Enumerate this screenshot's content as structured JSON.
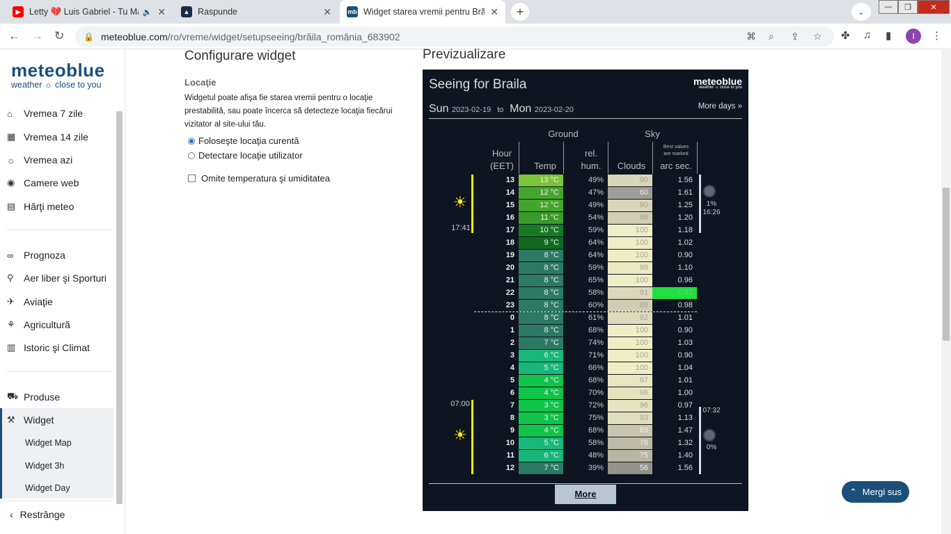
{
  "tabs": [
    {
      "title": "Letty 💔 Luis Gabriel - Tu Ma",
      "icon": "youtube-icon"
    },
    {
      "title": "Raspunde",
      "icon": "brainly-icon"
    },
    {
      "title": "Widget starea vremii pentru Brăil",
      "icon": "mb-icon",
      "icon_text": "mb"
    }
  ],
  "url": {
    "host": "meteoblue.com",
    "path": "/ro/vreme/widget/setupseeing/brăila_românia_683902"
  },
  "avatar": "I",
  "logo": {
    "name": "meteoblue",
    "tagline": "weather ☼ close to you"
  },
  "sidebar": {
    "group1": [
      "Vremea 7 zile",
      "Vremea 14 zile",
      "Vremea azi",
      "Camere web",
      "Hărţi meteo"
    ],
    "group2": [
      "Prognoza",
      "Aer liber şi Sporturi",
      "Aviaţie",
      "Agricultură",
      "Istoric şi Climat"
    ],
    "group3": [
      "Produse",
      "Widget"
    ],
    "sub": [
      "Widget Map",
      "Widget 3h",
      "Widget Day"
    ],
    "collapse": "Restrânge"
  },
  "config": {
    "title": "Configurare widget",
    "location_label": "Locaţie",
    "description": "Widgetul poate afişa fie starea vremii pentru o locaţie prestabilită, sau poate încerca să detecteze locaţia fiecărui vizitator al site-ului tău.",
    "option1": "Foloseşte locaţia curentă",
    "option2": "Detectare locaţie utilizator",
    "checkbox": "Omite temperatura şi umiditatea"
  },
  "preview_title": "Previzualizare",
  "widget": {
    "title": "Seeing for Braila",
    "logo_main": "meteoblue",
    "logo_sub": "weather ☼ close to you",
    "day1": "Sun",
    "date1": "2023-02-19",
    "to": "to",
    "day2": "Mon",
    "date2": "2023-02-20",
    "more_days": "More days »",
    "header": {
      "ground": "Ground",
      "sky": "Sky",
      "hour": "Hour",
      "eet": "(EET)",
      "temp": "Temp",
      "rel": "rel.",
      "hum": "hum.",
      "clouds": "Clouds",
      "best1": "Best values",
      "best2": "are marked",
      "arc": "arc sec."
    },
    "sunset": "17:41",
    "sunrise": "07:00",
    "moon1_pct": "1%",
    "moon1_time": "16:26",
    "moon2_time": "07:32",
    "moon2_pct": "0%",
    "more_button": "More",
    "rows": [
      {
        "h": "13",
        "t": "13 °C",
        "tc": "#7cc43a",
        "hum": "49%",
        "c": "90",
        "cc": "#d8d5b8",
        "a": "1.56"
      },
      {
        "h": "14",
        "t": "12 °C",
        "tc": "#45a62e",
        "hum": "47%",
        "c": "60",
        "cc": "#9d9c96",
        "a": "1.61"
      },
      {
        "h": "15",
        "t": "12 °C",
        "tc": "#45a62e",
        "hum": "49%",
        "c": "90",
        "cc": "#d8d5b8",
        "a": "1.25"
      },
      {
        "h": "16",
        "t": "11 °C",
        "tc": "#3b9a2c",
        "hum": "54%",
        "c": "86",
        "cc": "#d0cdb4",
        "a": "1.20"
      },
      {
        "h": "17",
        "t": "10 °C",
        "tc": "#157a22",
        "hum": "59%",
        "c": "100",
        "cc": "#efedc6",
        "a": "1.18"
      },
      {
        "h": "18",
        "t": "9 °C",
        "tc": "#0f6a20",
        "hum": "64%",
        "c": "100",
        "cc": "#efedc6",
        "a": "1.02"
      },
      {
        "h": "19",
        "t": "8 °C",
        "tc": "#2c7a64",
        "hum": "64%",
        "c": "100",
        "cc": "#efedc6",
        "a": "0.90"
      },
      {
        "h": "20",
        "t": "8 °C",
        "tc": "#2c7a64",
        "hum": "59%",
        "c": "98",
        "cc": "#ebe9c3",
        "a": "1.10"
      },
      {
        "h": "21",
        "t": "8 °C",
        "tc": "#2c7a64",
        "hum": "65%",
        "c": "100",
        "cc": "#efedc6",
        "a": "0.96"
      },
      {
        "h": "22",
        "t": "8 °C",
        "tc": "#2c7a64",
        "hum": "58%",
        "c": "91",
        "cc": "#dcd9bb",
        "a": "0.82",
        "best": true
      },
      {
        "h": "23",
        "t": "8 °C",
        "tc": "#2c7a64",
        "hum": "60%",
        "c": "86",
        "cc": "#d0cdb4",
        "a": "0.98"
      },
      {
        "h": "0",
        "t": "8 °C",
        "tc": "#2c7a64",
        "hum": "61%",
        "c": "92",
        "cc": "#dedbbc",
        "a": "1.01"
      },
      {
        "h": "1",
        "t": "8 °C",
        "tc": "#2c7a64",
        "hum": "68%",
        "c": "100",
        "cc": "#efedc6",
        "a": "0.90"
      },
      {
        "h": "2",
        "t": "7 °C",
        "tc": "#2c7a64",
        "hum": "74%",
        "c": "100",
        "cc": "#efedc6",
        "a": "1.03"
      },
      {
        "h": "3",
        "t": "6 °C",
        "tc": "#17b87a",
        "hum": "71%",
        "c": "100",
        "cc": "#efedc6",
        "a": "0.90"
      },
      {
        "h": "4",
        "t": "5 °C",
        "tc": "#17b87a",
        "hum": "66%",
        "c": "100",
        "cc": "#efedc6",
        "a": "1.04"
      },
      {
        "h": "5",
        "t": "4 °C",
        "tc": "#0fc448",
        "hum": "68%",
        "c": "97",
        "cc": "#e9e7c2",
        "a": "1.01"
      },
      {
        "h": "6",
        "t": "4 °C",
        "tc": "#0fc448",
        "hum": "70%",
        "c": "96",
        "cc": "#e6e4c0",
        "a": "1.00"
      },
      {
        "h": "7",
        "t": "3 °C",
        "tc": "#0fc448",
        "hum": "72%",
        "c": "96",
        "cc": "#e6e4c0",
        "a": "0.97"
      },
      {
        "h": "8",
        "t": "3 °C",
        "tc": "#0fc448",
        "hum": "75%",
        "c": "93",
        "cc": "#e0ddbd",
        "a": "1.13"
      },
      {
        "h": "9",
        "t": "4 °C",
        "tc": "#0fc448",
        "hum": "68%",
        "c": "83",
        "cc": "#c9c6ae",
        "a": "1.47"
      },
      {
        "h": "10",
        "t": "5 °C",
        "tc": "#17b87a",
        "hum": "58%",
        "c": "78",
        "cc": "#bdbba6",
        "a": "1.32"
      },
      {
        "h": "11",
        "t": "6 °C",
        "tc": "#17b87a",
        "hum": "48%",
        "c": "75",
        "cc": "#b8b6a2",
        "a": "1.40"
      },
      {
        "h": "12",
        "t": "7 °C",
        "tc": "#2c7a64",
        "hum": "39%",
        "c": "56",
        "cc": "#93928d",
        "a": "1.56"
      }
    ]
  },
  "go_top": "Mergi sus",
  "colors": {
    "brand": "#1b4f7a",
    "best": "#1fe040",
    "sunbar": "#ffee00"
  }
}
